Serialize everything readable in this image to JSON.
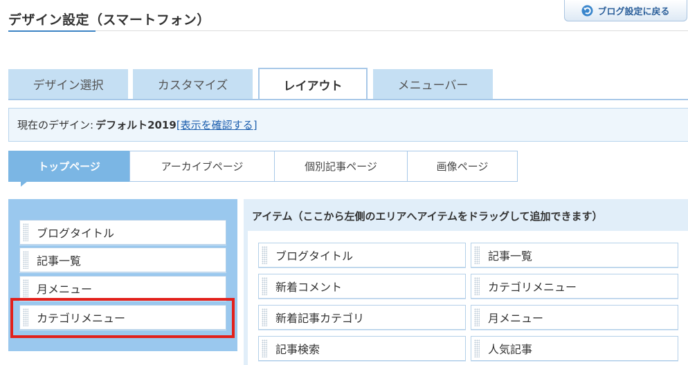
{
  "page_title": "デザイン設定（スマートフォン）",
  "back_button": {
    "label": "ブログ設定に戻る",
    "icon": "undo-arrow-icon"
  },
  "tabs": [
    {
      "label": "デザイン選択",
      "active": false
    },
    {
      "label": "カスタマイズ",
      "active": false
    },
    {
      "label": "レイアウト",
      "active": true
    },
    {
      "label": "メニューバー",
      "active": false
    }
  ],
  "design_bar": {
    "prefix": "現在のデザイン:",
    "design_name": "デフォルト2019",
    "bracket_open": "[",
    "link_label": "表示を確認する",
    "bracket_close": "]"
  },
  "sub_tabs": [
    {
      "label": "トップページ",
      "active": true
    },
    {
      "label": "アーカイブページ",
      "active": false
    },
    {
      "label": "個別記事ページ",
      "active": false
    },
    {
      "label": "画像ページ",
      "active": false
    }
  ],
  "layout_area": {
    "items": [
      "ブログタイトル",
      "記事一覧",
      "月メニュー",
      "カテゴリメニュー"
    ],
    "highlighted_item": "カテゴリメニュー"
  },
  "items_panel": {
    "header": "アイテム（ここから左側のエリアへアイテムをドラッグして追加できます）",
    "items": [
      "ブログタイトル",
      "記事一覧",
      "新着コメント",
      "カテゴリメニュー",
      "新着記事カテゴリ",
      "月メニュー",
      "記事検索",
      "人気記事"
    ]
  },
  "colors": {
    "accent_blue": "#3b83c4",
    "tab_inactive": "#c5dff3",
    "subtab_active": "#7bb6e4",
    "layout_panel": "#9ac8ee",
    "highlight_red": "#e2201b",
    "link": "#1d5fae"
  }
}
